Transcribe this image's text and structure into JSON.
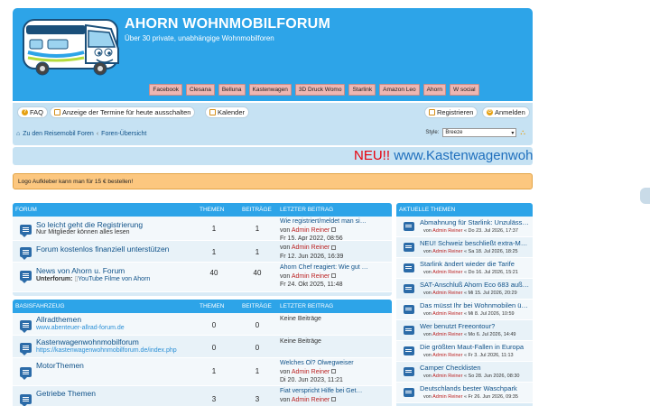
{
  "header": {
    "site_title": "AHORN WOHNMOBILFORUM",
    "site_desc": "Über 30 private, unabhängige Wohnmobilforen"
  },
  "links": [
    "Facebook",
    "Clesana",
    "Belluna",
    "Kastenwagen",
    "3D Druck Womo",
    "Starlink",
    "Amazon Leo",
    "Ahorn",
    "W social"
  ],
  "nav": {
    "faq": "FAQ",
    "anzeige": "Anzeige der Termine für heute ausschalten",
    "kalender": "Kalender",
    "registrieren": "Registrieren",
    "anmelden": "Anmelden",
    "breadcrumb_home": "Zu den Reisemobil Foren",
    "breadcrumb_sep": "‹",
    "breadcrumb_index": "Foren-Übersicht",
    "style_label": "Style:",
    "style_value": "Breeze"
  },
  "ticker": {
    "prefix": "NEU!!",
    "text": "www.Kastenwagenwohi"
  },
  "notice": "Logo Aufkleber kann man für 15 € bestellen!",
  "forum_head": {
    "col1": "FORUM",
    "col2": "THEMEN",
    "col3": "BEITRÄGE",
    "col4": "LETZTER BEITRAG"
  },
  "forums1": [
    {
      "title": "So leicht geht die Registrierung",
      "desc": "Nur Mitglieder können alles lesen",
      "topics": "1",
      "posts": "1",
      "lp_title": "Wie registriert/meldet man si…",
      "lp_by": "von",
      "lp_user": "Admin Reiner",
      "lp_date": "Fr 15. Apr 2022, 08:56"
    },
    {
      "title": "Forum kostenlos finanziell unterstützen",
      "desc": "",
      "topics": "1",
      "posts": "1",
      "lp_title": "",
      "lp_by": "von",
      "lp_user": "Admin Reiner",
      "lp_date": "Fr 12. Jun 2026, 16:39"
    },
    {
      "title": "News von Ahorn u. Forum",
      "sub_label": "Unterforum:",
      "sub_value": "YouTube Filme von Ahorn",
      "topics": "40",
      "posts": "40",
      "lp_title": "Ahorn Chef reagiert: Wie gut …",
      "lp_by": "von",
      "lp_user": "Admin Reiner",
      "lp_date": "Fr 24. Okt 2025, 11:48"
    }
  ],
  "forum_head2": {
    "col1": "BASISFAHRZEUG",
    "col2": "THEMEN",
    "col3": "BEITRÄGE",
    "col4": "LETZTER BEITRAG"
  },
  "forums2": [
    {
      "title": "Allradthemen",
      "link": "www.abenteuer-allrad-forum.de",
      "topics": "0",
      "posts": "0",
      "lp_title": "Keine Beiträge"
    },
    {
      "title": "Kastenwagenwohnmobilforum",
      "link": "https://kastenwagenwohnmobilforum.de/index.php",
      "topics": "0",
      "posts": "0",
      "lp_title": "Keine Beiträge"
    },
    {
      "title": "MotorThemen",
      "topics": "1",
      "posts": "1",
      "lp_title": "Welches Öl? Ölwegweiser",
      "lp_by": "von",
      "lp_user": "Admin Reiner",
      "lp_date": "Di 20. Jun 2023, 11:21"
    },
    {
      "title": "Getriebe Themen",
      "topics": "3",
      "posts": "3",
      "lp_title": "Fiat verspricht Hilfe bei Get…",
      "lp_by": "von",
      "lp_user": "Admin Reiner"
    }
  ],
  "topics_head": "AKTUELLE THEMEN",
  "topics": [
    {
      "title": "Abmahnung für Starlink: Unzuläss…",
      "by": "von",
      "user": "Admin Reiner",
      "date": "« Do 23. Jul 2026, 17:37"
    },
    {
      "title": "NEU! Schweiz beschließt extra-M…",
      "by": "von",
      "user": "Admin Reiner",
      "date": "« Sa 18. Jul 2026, 18:25"
    },
    {
      "title": "Starlink ändert wieder die Tarife",
      "by": "von",
      "user": "Admin Reiner",
      "date": "« Do 16. Jul 2026, 15:21"
    },
    {
      "title": "SAT-Anschluß Ahorn Eco 683 auß…",
      "by": "von",
      "user": "Admin Reiner",
      "date": "« Mi 15. Jul 2026, 20:29"
    },
    {
      "title": "Das müsst Ihr bei Wohnmobilen ü…",
      "by": "von",
      "user": "Admin Reiner",
      "date": "« Mi 8. Jul 2026, 10:59"
    },
    {
      "title": "Wer benutzt Freeontour?",
      "by": "von",
      "user": "Admin Reiner",
      "date": "« Mo 6. Jul 2026, 14:49"
    },
    {
      "title": "Die größten Maut-Fallen in Europa",
      "by": "von",
      "user": "Admin Reiner",
      "date": "« Fr 3. Jul 2026, 11:13"
    },
    {
      "title": "Camper Checklisten",
      "by": "von",
      "user": "Admin Reiner",
      "date": "« So 28. Jun 2026, 08:30"
    },
    {
      "title": "Deutschlands bester Waschpark",
      "by": "von",
      "user": "Admin Reiner",
      "date": "« Fr 26. Jun 2026, 09:35"
    }
  ]
}
